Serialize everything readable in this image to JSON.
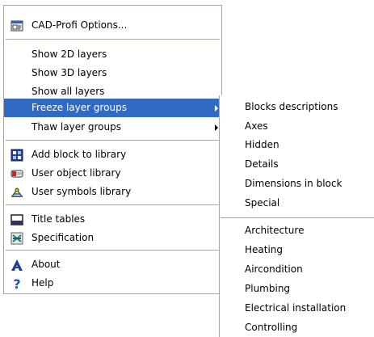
{
  "colors": {
    "menu_background": "#ffffff",
    "border": "#aca899",
    "highlight": "#316ac5",
    "highlight_text": "#ffffff"
  },
  "main_menu": {
    "options_label": "CAD-Profi Options...",
    "show_2d": "Show 2D layers",
    "show_3d": "Show 3D layers",
    "show_all": "Show all layers",
    "freeze_groups": "Freeze layer groups",
    "thaw_groups": "Thaw layer groups",
    "add_block": "Add block to library",
    "user_object_library": "User object library",
    "user_symbols_library": "User symbols library",
    "title_tables": "Title tables",
    "specification": "Specification",
    "about": "About",
    "help": "Help"
  },
  "icons": {
    "options": "options-icon",
    "add_block": "add-block-icon",
    "user_object_library": "user-object-library-icon",
    "user_symbols_library": "user-symbols-library-icon",
    "title_tables": "title-tables-icon",
    "specification": "specification-icon",
    "about": "about-icon",
    "help": "help-icon"
  },
  "submenu": {
    "items": [
      "Blocks descriptions",
      "Axes",
      "Hidden",
      "Details",
      "Dimensions in block",
      "Special",
      "Architecture",
      "Heating",
      "Aircondition",
      "Plumbing",
      "Electrical installation",
      "Controlling"
    ]
  }
}
